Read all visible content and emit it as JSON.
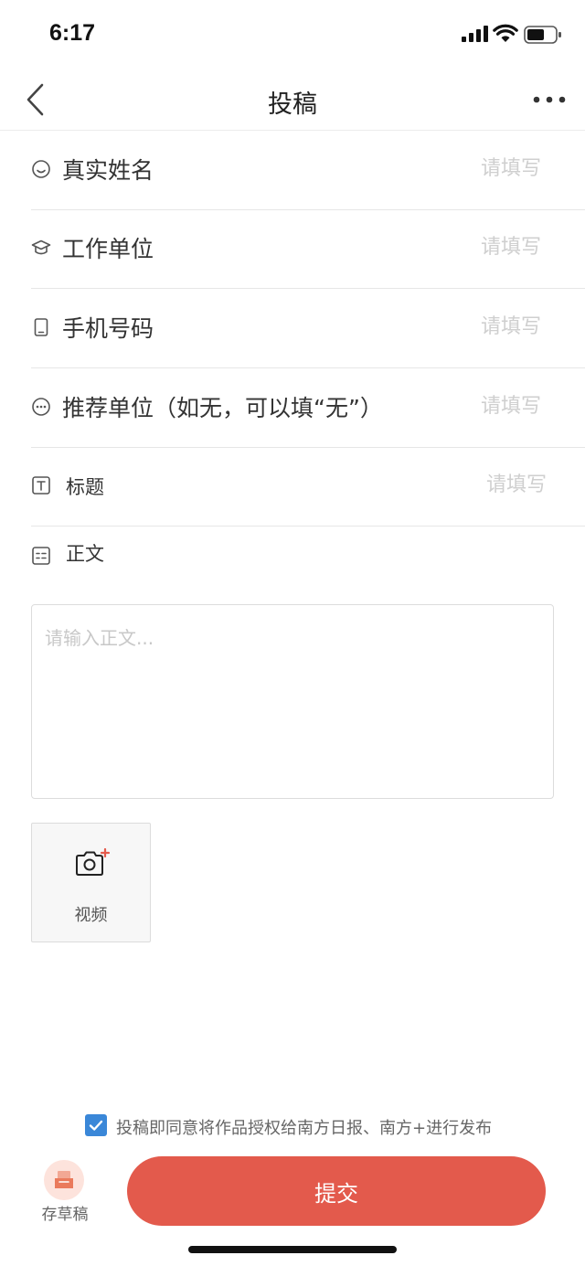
{
  "status_bar": {
    "time": "6:17"
  },
  "nav": {
    "title": "投稿"
  },
  "form": {
    "fields": [
      {
        "label": "真实姓名",
        "placeholder": "请填写",
        "icon": "smile-icon"
      },
      {
        "label": "工作单位",
        "placeholder": "请填写",
        "icon": "graduation-cap-icon"
      },
      {
        "label": "手机号码",
        "placeholder": "请填写",
        "icon": "phone-icon"
      },
      {
        "label": "推荐单位（如无，可以填“无”）",
        "placeholder": "请填写",
        "icon": "chat-bubble-icon"
      },
      {
        "label": "标题",
        "placeholder": "请填写",
        "icon": "title-icon"
      }
    ],
    "body": {
      "label": "正文",
      "placeholder": "请输入正文...",
      "icon": "text-icon"
    }
  },
  "upload": {
    "video_label": "视频",
    "icon": "camera-add-icon"
  },
  "agreement": {
    "checked": true,
    "text": "投稿即同意将作品授权给南方日报、南方+进行发布"
  },
  "actions": {
    "draft_label": "存草稿",
    "submit_label": "提交"
  },
  "colors": {
    "accent": "#e35a4c",
    "checkbox": "#3a87d8",
    "placeholder": "#cfcfcf"
  }
}
